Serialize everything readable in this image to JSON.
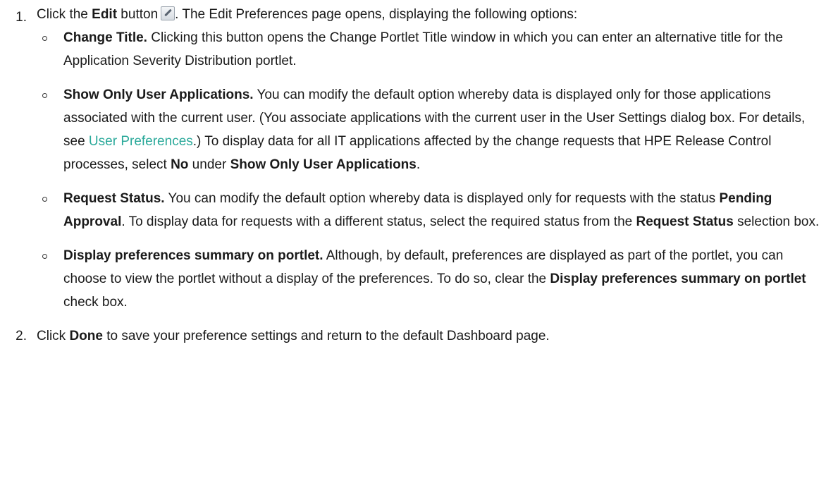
{
  "step1": {
    "num": "1.",
    "pre": "Click the ",
    "edit_bold": "Edit",
    "button_word": " button",
    "post": ". The Edit Preferences page opens, displaying the following options:",
    "edit_icon": "pencil-icon"
  },
  "opt1": {
    "title": "Change Title.",
    "text": " Clicking this button opens the Change Portlet Title window in which you can enter an alternative title for the Application Severity Distribution portlet."
  },
  "opt2": {
    "title": "Show Only User Applications.",
    "text1": " You can modify the default option whereby data is displayed only for those applications associated with the current user. (You associate applications with the current user in the User Settings dialog box. For details, see ",
    "link": "User Preferences",
    "text2": ".) To display data for all IT applications affected by the change requests that HPE Release Control processes, select ",
    "b1": "No",
    "text3": " under ",
    "b2": "Show Only User Applications",
    "text4": "."
  },
  "opt3": {
    "title": "Request Status.",
    "text1": " You can modify the default option whereby data is displayed only for requests with the status ",
    "b1": "Pending Approval",
    "text2": ". To display data for requests with a different status, select the required status from the ",
    "b2": "Request Status",
    "text3": " selection box."
  },
  "opt4": {
    "title": "Display preferences summary on portlet.",
    "text1": " Although, by default, preferences are displayed as part of the portlet, you can choose to view the portlet without a display of the preferences. To do so, clear the ",
    "b1": "Display preferences summary on portlet",
    "text2": " check box."
  },
  "step2": {
    "num": "2.",
    "pre": "Click ",
    "b1": "Done",
    "post": " to save your preference settings and return to the default Dashboard page."
  },
  "colors": {
    "link": "#2aa99a",
    "text": "#1a1a1a"
  }
}
